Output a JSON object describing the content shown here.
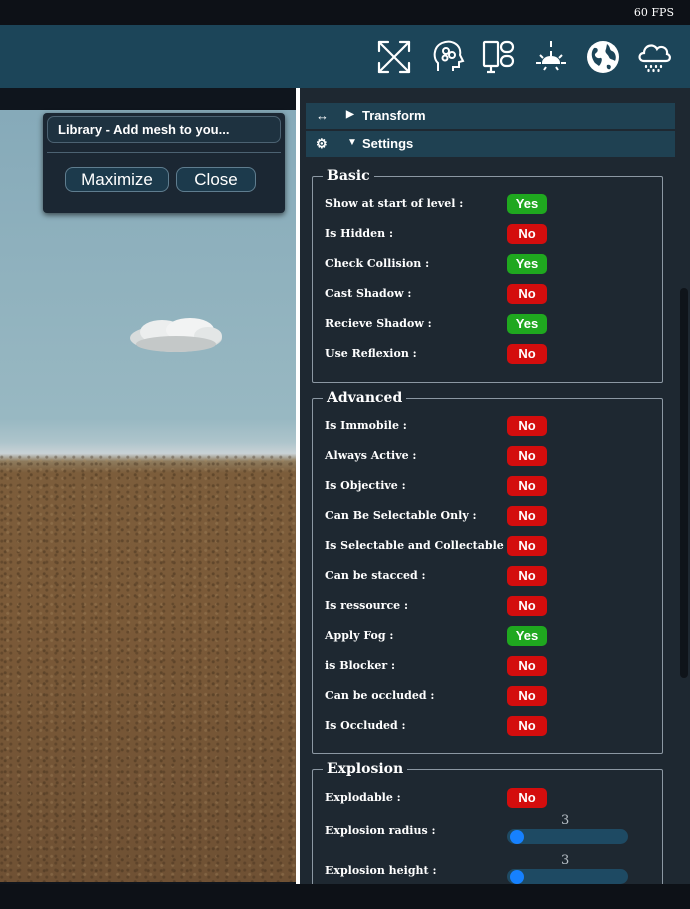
{
  "status": {
    "fps": "60 FPS"
  },
  "toolbar": {
    "icons": [
      "expand-arrows-icon",
      "brain-head-icon",
      "ui-layout-icon",
      "light-bulb-icon",
      "globe-icon",
      "rain-cloud-icon"
    ]
  },
  "library": {
    "title": "Library - Add mesh to you...",
    "maximize_label": "Maximize",
    "close_label": "Close"
  },
  "panel": {
    "transform_header": "Transform",
    "settings_header": "Settings",
    "basic": {
      "legend": "Basic",
      "rows": [
        {
          "label": "Show at start of level :",
          "value": "Yes"
        },
        {
          "label": "Is Hidden :",
          "value": "No"
        },
        {
          "label": "Check Collision :",
          "value": "Yes"
        },
        {
          "label": "Cast Shadow :",
          "value": "No"
        },
        {
          "label": "Recieve Shadow :",
          "value": "Yes"
        },
        {
          "label": "Use Reflexion :",
          "value": "No"
        }
      ]
    },
    "advanced": {
      "legend": "Advanced",
      "rows": [
        {
          "label": "Is Immobile :",
          "value": "No"
        },
        {
          "label": "Always Active :",
          "value": "No"
        },
        {
          "label": "Is Objective :",
          "value": "No"
        },
        {
          "label": "Can Be Selectable Only :",
          "value": "No"
        },
        {
          "label": "Is Selectable and Collectable :",
          "value": "No"
        },
        {
          "label": "Can be stacced :",
          "value": "No"
        },
        {
          "label": "Is ressource :",
          "value": "No"
        },
        {
          "label": "Apply Fog :",
          "value": "Yes"
        },
        {
          "label": "is Blocker :",
          "value": "No"
        },
        {
          "label": "Can be occluded :",
          "value": "No"
        },
        {
          "label": "Is Occluded :",
          "value": "No"
        }
      ]
    },
    "explosion": {
      "legend": "Explosion",
      "explodable_label": "Explodable :",
      "explodable_value": "No",
      "radius_label": "Explosion radius :",
      "radius_value": "3",
      "height_label": "Explosion height :",
      "height_value": "3"
    }
  },
  "colors": {
    "yes": "#1fa81f",
    "no": "#d40d0d",
    "toolbar": "#1c4559",
    "section_header": "#1f4152"
  }
}
